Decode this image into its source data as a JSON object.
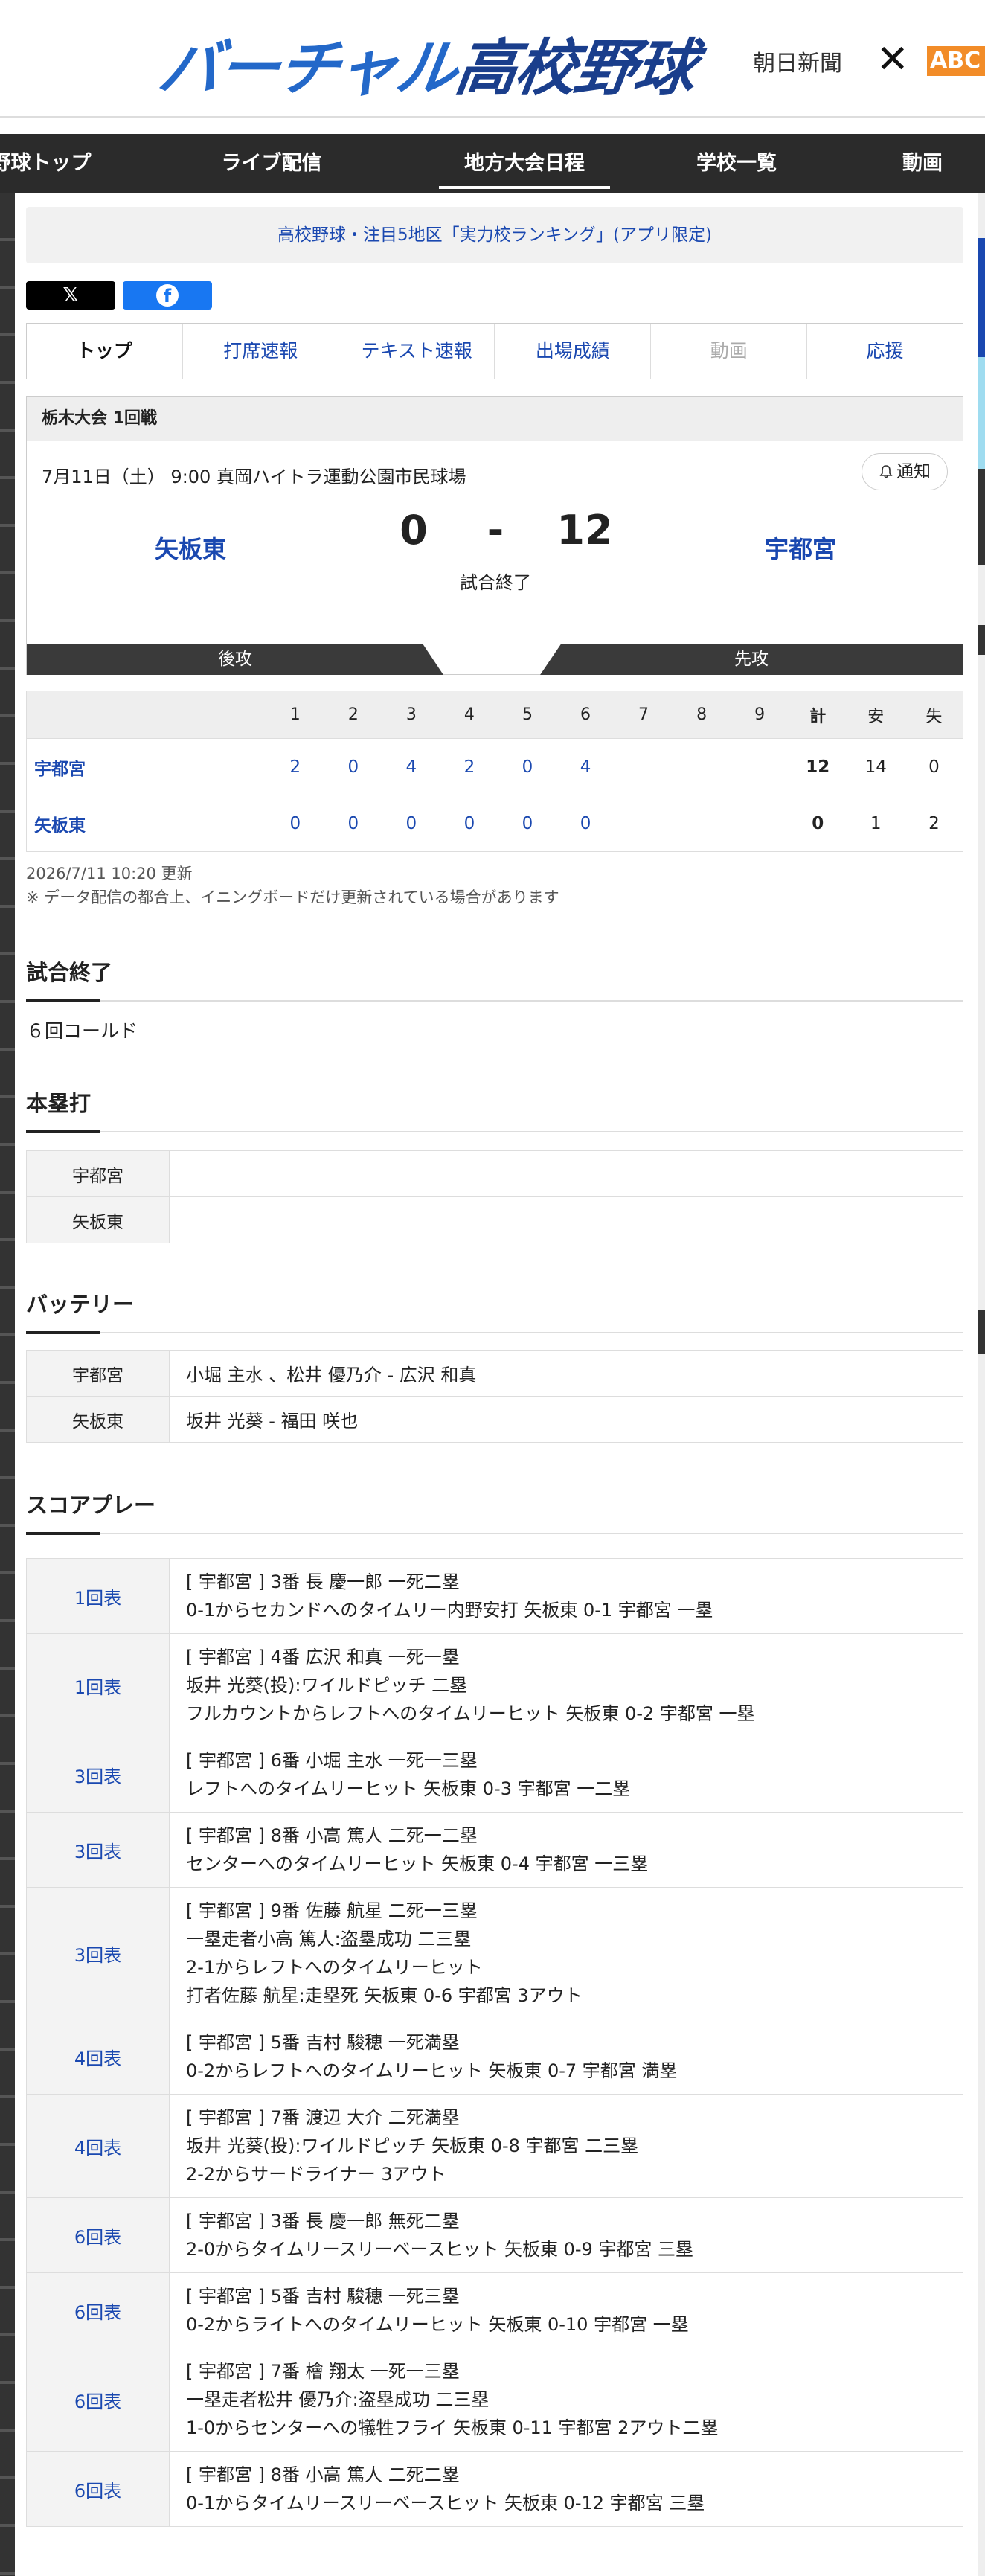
{
  "header": {
    "logo_part1": "バーチャル",
    "logo_part2": "高校野球",
    "asahi": "朝日新聞",
    "close": "✕",
    "abc": "ABC"
  },
  "nav": [
    "野球トップ",
    "ライブ配信",
    "地方大会日程",
    "学校一覧",
    "動画"
  ],
  "promo": "高校野球・注目5地区「実力校ランキング」(アプリ限定)",
  "share": {
    "x": "𝕏",
    "fb": "f"
  },
  "tabs": [
    "トップ",
    "打席速報",
    "テキスト速報",
    "出場成績",
    "動画",
    "応援"
  ],
  "game": {
    "title": "栃木大会 1回戦",
    "date": "7月11日（土） 9:00 真岡ハイトラ運動公園市民球場",
    "notify": "通知",
    "home_team": "矢板東",
    "away_team": "宇都宮",
    "home_score": "0",
    "dash": "-",
    "away_score": "12",
    "status": "試合終了",
    "home_side": "後攻",
    "away_side": "先攻"
  },
  "board": {
    "headers": [
      "1",
      "2",
      "3",
      "4",
      "5",
      "6",
      "7",
      "8",
      "9",
      "計",
      "安",
      "失"
    ],
    "rows": [
      {
        "team": "宇都宮",
        "innings": [
          "2",
          "0",
          "4",
          "2",
          "0",
          "4",
          "",
          "",
          ""
        ],
        "r": "12",
        "h": "14",
        "e": "0"
      },
      {
        "team": "矢板東",
        "innings": [
          "0",
          "0",
          "0",
          "0",
          "0",
          "0",
          "",
          "",
          ""
        ],
        "r": "0",
        "h": "1",
        "e": "2"
      }
    ]
  },
  "updated": "2026/7/11 10:20 更新",
  "note": "※ データ配信の都合上、イニングボードだけ更新されている場合があります",
  "result": {
    "title": "試合終了",
    "text": "６回コールド"
  },
  "homerun": {
    "title": "本塁打",
    "rows": [
      {
        "team": "宇都宮",
        "value": ""
      },
      {
        "team": "矢板東",
        "value": ""
      }
    ]
  },
  "battery": {
    "title": "バッテリー",
    "rows": [
      {
        "team": "宇都宮",
        "value": "小堀 主水 、松井 優乃介  - 広沢 和真"
      },
      {
        "team": "矢板東",
        "value": "坂井 光葵  - 福田 咲也"
      }
    ]
  },
  "plays": {
    "title": "スコアプレー",
    "rows": [
      {
        "inning": "1回表",
        "lines": [
          "[ 宇都宮 ] 3番 長 慶一郎 一死二塁",
          "0-1からセカンドへのタイムリー内野安打 矢板東 0-1 宇都宮 一塁"
        ]
      },
      {
        "inning": "1回表",
        "lines": [
          "[ 宇都宮 ] 4番 広沢 和真 一死一塁",
          "坂井 光葵(投):ワイルドピッチ 二塁",
          "フルカウントからレフトへのタイムリーヒット 矢板東 0-2 宇都宮 一塁"
        ]
      },
      {
        "inning": "3回表",
        "lines": [
          "[ 宇都宮 ] 6番 小堀 主水 一死一三塁",
          "レフトへのタイムリーヒット 矢板東 0-3 宇都宮 一二塁"
        ]
      },
      {
        "inning": "3回表",
        "lines": [
          "[ 宇都宮 ] 8番 小高 篤人 二死一二塁",
          "センターへのタイムリーヒット 矢板東 0-4 宇都宮 一三塁"
        ]
      },
      {
        "inning": "3回表",
        "lines": [
          "[ 宇都宮 ] 9番 佐藤 航星 二死一三塁",
          "一塁走者小高 篤人:盗塁成功 二三塁",
          "2-1からレフトへのタイムリーヒット",
          "打者佐藤 航星:走塁死 矢板東 0-6 宇都宮 3アウト"
        ]
      },
      {
        "inning": "4回表",
        "lines": [
          "[ 宇都宮 ] 5番 吉村 駿穂 一死満塁",
          "0-2からレフトへのタイムリーヒット 矢板東 0-7 宇都宮 満塁"
        ]
      },
      {
        "inning": "4回表",
        "lines": [
          "[ 宇都宮 ] 7番 渡辺 大介 二死満塁",
          "坂井 光葵(投):ワイルドピッチ 矢板東 0-8 宇都宮 二三塁",
          "2-2からサードライナー 3アウト"
        ]
      },
      {
        "inning": "6回表",
        "lines": [
          "[ 宇都宮 ] 3番 長 慶一郎 無死二塁",
          "2-0からタイムリースリーベースヒット 矢板東 0-9 宇都宮 三塁"
        ]
      },
      {
        "inning": "6回表",
        "lines": [
          "[ 宇都宮 ] 5番 吉村 駿穂 一死三塁",
          "0-2からライトへのタイムリーヒット 矢板東 0-10 宇都宮 一塁"
        ]
      },
      {
        "inning": "6回表",
        "lines": [
          "[ 宇都宮 ] 7番 檜 翔太 一死一三塁",
          "一塁走者松井 優乃介:盗塁成功 二三塁",
          "1-0からセンターへの犠牲フライ 矢板東 0-11 宇都宮 2アウト二塁"
        ]
      },
      {
        "inning": "6回表",
        "lines": [
          "[ 宇都宮 ] 8番 小高 篤人 二死二塁",
          "0-1からタイムリースリーベースヒット 矢板東 0-12 宇都宮 三塁"
        ]
      }
    ]
  }
}
